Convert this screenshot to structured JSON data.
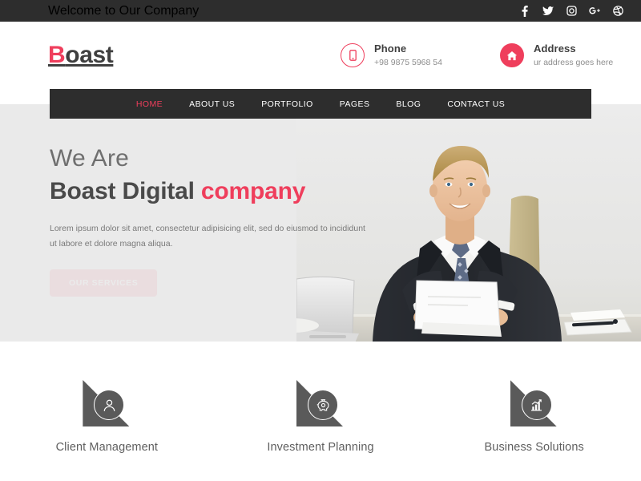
{
  "topbar": {
    "welcome": "Welcome to Our Company",
    "socials": [
      {
        "name": "facebook-icon",
        "label": "Facebook"
      },
      {
        "name": "twitter-icon",
        "label": "Twitter"
      },
      {
        "name": "instagram-icon",
        "label": "Instagram"
      },
      {
        "name": "google-plus-icon",
        "label": "Google Plus"
      },
      {
        "name": "dribbble-icon",
        "label": "Dribbble"
      }
    ]
  },
  "header": {
    "logo_accent": "B",
    "logo_rest": "oast",
    "contacts": [
      {
        "icon": "phone-icon",
        "title": "Phone",
        "value": "+98 9875 5968 54"
      },
      {
        "icon": "home-icon",
        "title": "Address",
        "value": "ur address goes here"
      }
    ]
  },
  "nav": {
    "items": [
      {
        "label": "HOME",
        "active": true
      },
      {
        "label": "ABOUT US",
        "active": false
      },
      {
        "label": "PORTFOLIO",
        "active": false
      },
      {
        "label": "PAGES",
        "active": false
      },
      {
        "label": "BLOG",
        "active": false
      },
      {
        "label": "CONTACT US",
        "active": false
      }
    ]
  },
  "hero": {
    "line1": "We Are",
    "line2_dark": "Boast Digital ",
    "line2_accent": "company",
    "paragraph": "Lorem ipsum dolor sit amet, consectetur adipisicing elit, sed do eiusmod to incididunt ut labore et dolore magna aliqua.",
    "button_label": "OUR SERVICES",
    "photo_alt": "businessman-at-desk-photo"
  },
  "services": {
    "cards": [
      {
        "icon": "user-circle-icon",
        "label": "Client Management"
      },
      {
        "icon": "piggy-bank-icon",
        "label": "Investment Planning"
      },
      {
        "icon": "bar-chart-icon",
        "label": "Business Solutions"
      }
    ]
  },
  "colors": {
    "accent": "#ef3e5c",
    "dark": "#2d2d2d",
    "hero_bg": "#eaeaea",
    "icon_gray": "#5a5a5a"
  }
}
